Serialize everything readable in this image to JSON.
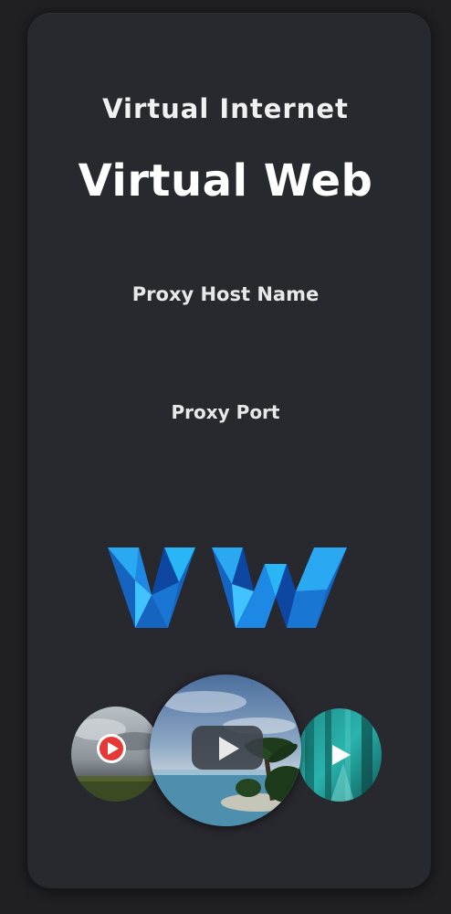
{
  "header": {
    "subtitle": "Virtual Internet",
    "title": "Virtual Web"
  },
  "fields": {
    "proxy_host_label": "Proxy Host Name",
    "proxy_port_label": "Proxy Port"
  },
  "logo": {
    "icon": "vw-logo-icon",
    "colors": [
      "#1e6fd9",
      "#2aa8f2",
      "#0d4fb5",
      "#45c3ff"
    ]
  },
  "media_bubbles": [
    {
      "icon": "youtube-play-icon",
      "accent": "#e53935"
    },
    {
      "icon": "video-play-icon",
      "accent": "#ffffff"
    },
    {
      "icon": "play-icon",
      "accent": "#ffffff"
    }
  ]
}
